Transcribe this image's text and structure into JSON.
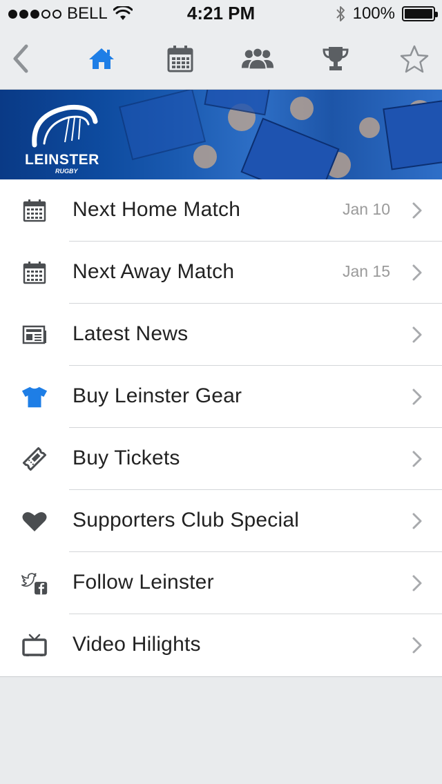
{
  "status_bar": {
    "carrier": "BELL",
    "time": "4:21 PM",
    "battery": "100%",
    "signal_bars_filled": 3,
    "signal_bars_total": 5,
    "battery_level": 1.0
  },
  "nav": {
    "icons": [
      "back-chevron-icon",
      "home-icon",
      "calendar-icon",
      "group-icon",
      "trophy-icon",
      "star-icon"
    ],
    "active": "home-icon",
    "active_color": "#1e7ee6",
    "inactive_color": "#5b5f63"
  },
  "banner": {
    "logo_text": "LEINSTER",
    "logo_subtext": "RUGBY",
    "brand_color": "#0d4a9e"
  },
  "menu": {
    "items": [
      {
        "label": "Next Home Match",
        "date": "Jan 10",
        "icon": "calendar-icon"
      },
      {
        "label": "Next Away Match",
        "date": "Jan 15",
        "icon": "calendar-icon"
      },
      {
        "label": "Latest News",
        "icon": "newspaper-icon"
      },
      {
        "label": "Buy Leinster Gear",
        "icon": "jersey-icon"
      },
      {
        "label": "Buy Tickets",
        "icon": "ticket-icon"
      },
      {
        "label": "Supporters Club Special",
        "icon": "heart-icon"
      },
      {
        "label": "Follow Leinster",
        "icon": "twitter-facebook-icon"
      },
      {
        "label": "Video Hilights",
        "icon": "tv-icon"
      }
    ],
    "accent_color": "#1e7ee6",
    "icon_color": "#4a4d50",
    "chevron_color": "#a8aaad"
  }
}
